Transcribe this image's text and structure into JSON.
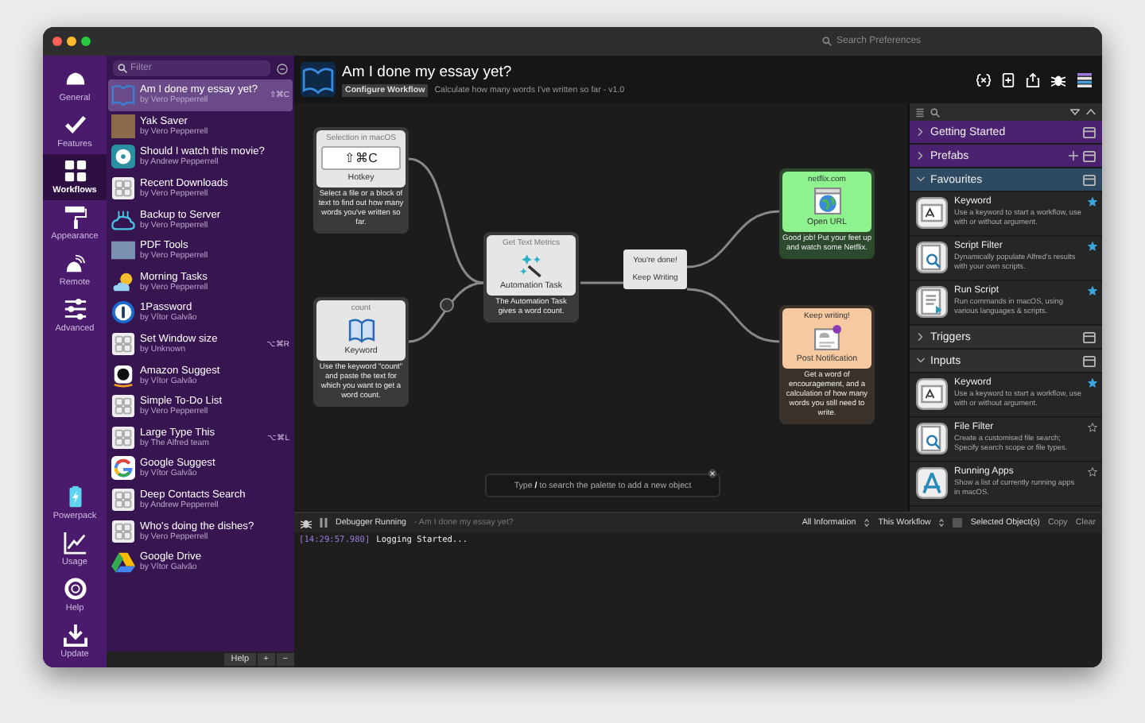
{
  "window": {
    "search_placeholder": "Search Preferences"
  },
  "nav": {
    "items": [
      {
        "label": "General",
        "selected": false
      },
      {
        "label": "Features",
        "selected": false
      },
      {
        "label": "Workflows",
        "selected": true
      },
      {
        "label": "Appearance",
        "selected": false
      },
      {
        "label": "Remote",
        "selected": false
      },
      {
        "label": "Advanced",
        "selected": false
      }
    ],
    "bottom_items": [
      {
        "label": "Powerpack"
      },
      {
        "label": "Usage"
      },
      {
        "label": "Help"
      },
      {
        "label": "Update"
      }
    ]
  },
  "workflows": {
    "filter_placeholder": "Filter",
    "items": [
      {
        "title": "Am I done my essay yet?",
        "author": "by Vero Pepperrell",
        "hotkey": "⇧⌘C",
        "selected": true
      },
      {
        "title": "Yak Saver",
        "author": "by Vero Pepperrell",
        "selected": false
      },
      {
        "title": "Should I watch this movie?",
        "author": "by Andrew Pepperrell",
        "selected": false
      },
      {
        "title": "Recent Downloads",
        "author": "by Vero Pepperrell",
        "selected": false
      },
      {
        "title": "Backup to Server",
        "author": "by Vero Pepperrell",
        "selected": false
      },
      {
        "title": "PDF Tools",
        "author": "by Vero Pepperrell",
        "selected": false
      },
      {
        "title": "Morning Tasks",
        "author": "by Vero Pepperrell",
        "selected": false
      },
      {
        "title": "1Password",
        "author": "by Vítor Galvão",
        "selected": false
      },
      {
        "title": "Set Window size",
        "author": "by Unknown",
        "hotkey": "⌥⌘R",
        "selected": false
      },
      {
        "title": "Amazon Suggest",
        "author": "by Vítor Galvão",
        "selected": false
      },
      {
        "title": "Simple To-Do List",
        "author": "by Vero Pepperrell",
        "selected": false
      },
      {
        "title": "Large Type This",
        "author": "by The Alfred team",
        "hotkey": "⌥⌘L",
        "selected": false
      },
      {
        "title": "Google Suggest",
        "author": "by Vítor Galvão",
        "selected": false
      },
      {
        "title": "Deep Contacts Search",
        "author": "by Andrew Pepperrell",
        "selected": false
      },
      {
        "title": "Who's doing the dishes?",
        "author": "by Vero Pepperrell",
        "selected": false
      },
      {
        "title": "Google Drive",
        "author": "by Vítor Galvão",
        "selected": false
      }
    ],
    "footer": {
      "help": "Help",
      "add": "+",
      "remove": "−"
    }
  },
  "editor": {
    "title": "Am I done my essay yet?",
    "configure_button": "Configure Workflow",
    "description": "Calculate how many words I've written so far - v1.0"
  },
  "canvas": {
    "nodes": [
      {
        "kind": "hotkey",
        "header": "Selection in macOS",
        "key": "⇧⌘C",
        "label": "Hotkey",
        "note": "Select a file or a block of text to find out how many words you've written so far."
      },
      {
        "kind": "keyword",
        "header": "count",
        "label": "Keyword",
        "note": "Use the keyword \"count\" and paste the text for which you want to get a word count."
      },
      {
        "kind": "action",
        "header": "Get Text Metrics",
        "label": "Automation Task",
        "note": "The Automation Task gives a word count."
      },
      {
        "kind": "conditional",
        "outputs": [
          "You're done!",
          "Keep Writing"
        ]
      },
      {
        "kind": "url",
        "header": "netflix.com",
        "label": "Open URL",
        "note": "Good job! Put your feet up and watch some Netflix."
      },
      {
        "kind": "notification",
        "header": "Keep writing!",
        "label": "Post Notification",
        "note": "Get a word of encouragement, and a calculation of how many words you still need to write."
      }
    ],
    "hint": "Type **/** to search the palette to add a new object"
  },
  "debugger": {
    "status": "Debugger Running",
    "workflow": "- Am I done my essay yet?",
    "filter": "All Information",
    "scope": "This Workflow",
    "selected_only": {
      "label": "Selected Object(s)",
      "checked": false
    },
    "buttons": [
      "Copy",
      "Clear"
    ],
    "log": [
      {
        "time": "[14:29:57.980]",
        "message": "Logging Started..."
      }
    ]
  },
  "palette": {
    "sections": [
      {
        "title": "Getting Started",
        "expanded": false,
        "color": "#4b2270"
      },
      {
        "title": "Prefabs",
        "expanded": false,
        "color": "#4b2270"
      },
      {
        "title": "Favourites",
        "expanded": true,
        "color": "#2d4a62",
        "items": [
          {
            "title": "Keyword",
            "description": "Use a keyword to start a workflow, use with or without argument.",
            "starred": true
          },
          {
            "title": "Script Filter",
            "description": "Dynamically populate Alfred's results with your own scripts.",
            "starred": true
          },
          {
            "title": "Run Script",
            "description": "Run commands in macOS, using various languages & scripts.",
            "starred": true
          }
        ]
      },
      {
        "title": "Triggers",
        "expanded": false,
        "color": "#303030"
      },
      {
        "title": "Inputs",
        "expanded": true,
        "color": "#303030",
        "items": [
          {
            "title": "Keyword",
            "description": "Use a keyword to start a workflow, use with or without argument.",
            "starred": true
          },
          {
            "title": "File Filter",
            "description": "Create a customised file search; Specify search scope or file types.",
            "starred": false
          },
          {
            "title": "Running Apps",
            "description": "Show a list of currently running apps in macOS.",
            "starred": false
          }
        ]
      }
    ]
  }
}
